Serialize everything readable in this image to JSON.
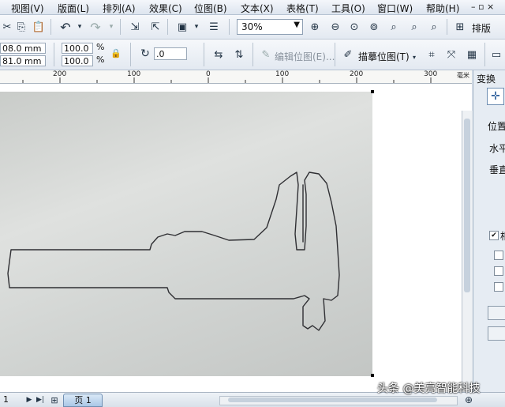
{
  "menu": [
    "视图(V)",
    "版面(L)",
    "排列(A)",
    "效果(C)",
    "位图(B)",
    "文本(X)",
    "表格(T)",
    "工具(O)",
    "窗口(W)",
    "帮助(H)"
  ],
  "toolbar": {
    "zoom_value": "30%",
    "layout_label": "排版"
  },
  "property_bar": {
    "x_value": "08.0 mm",
    "y_value": "81.0 mm",
    "scale_x": "100.0",
    "scale_y": "100.0",
    "percent_symbol": "%",
    "rotation_value": ".0",
    "edit_bitmap_label": "编辑位图(E)...",
    "trace_bitmap_label": "描摹位图(T)"
  },
  "ruler": {
    "ticks": [
      "200",
      "100",
      "0",
      "100",
      "200",
      "300"
    ],
    "unit": "毫米"
  },
  "docker": {
    "tab_label": "变换",
    "position_label": "位置",
    "horizontal_label": "水平",
    "vertical_label": "垂直",
    "relative_label": "相"
  },
  "status": {
    "page_number": "1",
    "page_tab": "页 1"
  },
  "watermark": "头条 @美亮智能科技",
  "colors": {
    "menubar": "#e6ecf3",
    "canvas": "#ffffff",
    "photo": "#d5d8d6",
    "sketch_line": "#2f2f33"
  }
}
